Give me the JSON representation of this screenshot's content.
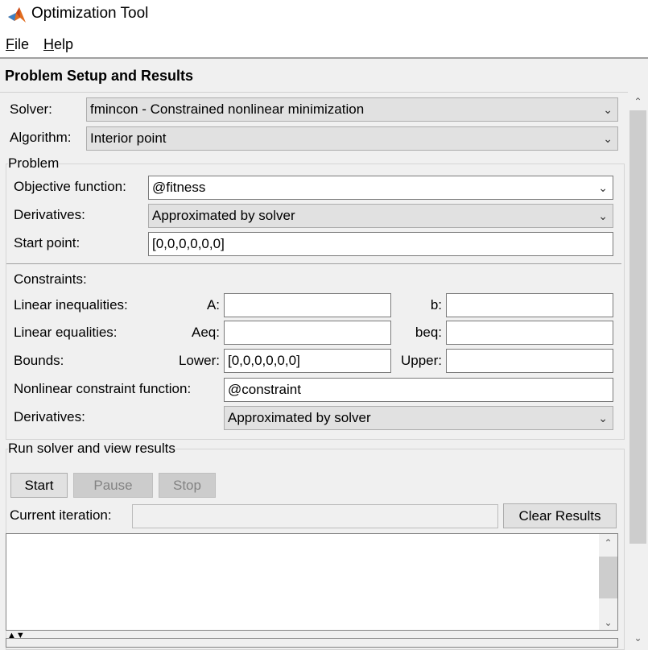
{
  "window": {
    "title": "Optimization Tool"
  },
  "menu": {
    "file": "File",
    "help": "Help"
  },
  "panel_title": "Problem Setup and Results",
  "solver": {
    "label": "Solver:",
    "value": "fmincon - Constrained nonlinear minimization"
  },
  "algorithm": {
    "label": "Algorithm:",
    "value": "Interior point"
  },
  "problem": {
    "title": "Problem",
    "objective_label": "Objective function:",
    "objective_value": "@fitness",
    "derivatives_label": "Derivatives:",
    "derivatives_value": "Approximated by solver",
    "start_label": "Start point:",
    "start_value": "[0,0,0,0,0,0]"
  },
  "constraints": {
    "title": "Constraints:",
    "lin_ineq": "Linear inequalities:",
    "a_label": "A:",
    "a_value": "",
    "b_label": "b:",
    "b_value": "",
    "lin_eq": "Linear equalities:",
    "aeq_label": "Aeq:",
    "aeq_value": "",
    "beq_label": "beq:",
    "beq_value": "",
    "bounds": "Bounds:",
    "lower_label": "Lower:",
    "lower_value": "[0,0,0,0,0,0]",
    "upper_label": "Upper:",
    "upper_value": "",
    "nonlin_label": "Nonlinear constraint function:",
    "nonlin_value": "@constraint",
    "derivatives_label": "Derivatives:",
    "derivatives_value": "Approximated by solver"
  },
  "run": {
    "title": "Run solver and view results",
    "start": "Start",
    "pause": "Pause",
    "stop": "Stop",
    "iteration_label": "Current iteration:",
    "iteration_value": "",
    "clear": "Clear Results",
    "output": ""
  }
}
